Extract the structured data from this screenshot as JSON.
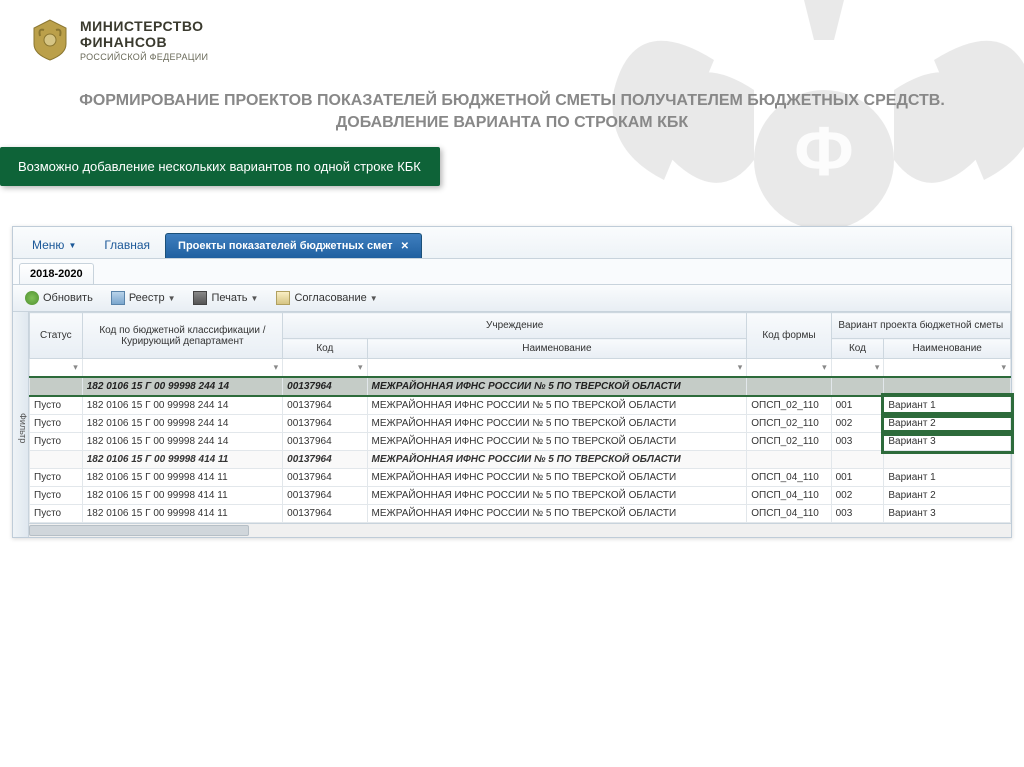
{
  "header": {
    "ministry_line1": "МИНИСТЕРСТВО",
    "ministry_line2": "ФИНАНСОВ",
    "ministry_line3": "РОССИЙСКОЙ ФЕДЕРАЦИИ"
  },
  "title": "ФОРМИРОВАНИЕ ПРОЕКТОВ ПОКАЗАТЕЛЕЙ БЮДЖЕТНОЙ СМЕТЫ ПОЛУЧАТЕЛЕМ БЮДЖЕТНЫХ СРЕДСТВ. ДОБАВЛЕНИЕ ВАРИАНТА ПО СТРОКАМ КБК",
  "callout": "Возможно добавление нескольких вариантов по одной строке КБК",
  "tabs": {
    "menu": "Меню",
    "home": "Главная",
    "active": "Проекты показателей бюджетных смет"
  },
  "subtab": "2018-2020",
  "toolbar": {
    "refresh": "Обновить",
    "registry": "Реестр",
    "print": "Печать",
    "approval": "Согласование"
  },
  "filter_label": "Фильтр",
  "columns": {
    "status": "Статус",
    "kbk": "Код по бюджетной классификации / Курирующий департамент",
    "institution": "Учреждение",
    "inst_kod": "Код",
    "inst_name": "Наименование",
    "form": "Код формы",
    "variant": "Вариант проекта бюджетной сметы",
    "var_kod": "Код",
    "var_name": "Наименование"
  },
  "groups": [
    {
      "highlight": true,
      "kbk": "182 0106 15 Г 00 99998 244 14",
      "kod": "00137964",
      "name": "МЕЖРАЙОННАЯ ИФНС РОССИИ № 5 ПО ТВЕРСКОЙ ОБЛАСТИ",
      "rows": [
        {
          "status": "Пусто",
          "kbk": "182 0106 15 Г 00 99998 244 14",
          "kod": "00137964",
          "name": "МЕЖРАЙОННАЯ ИФНС РОССИИ № 5 ПО ТВЕРСКОЙ ОБЛАСТИ",
          "form": "ОПСП_02_110",
          "vkod": "001",
          "vname": "Вариант 1"
        },
        {
          "status": "Пусто",
          "kbk": "182 0106 15 Г 00 99998 244 14",
          "kod": "00137964",
          "name": "МЕЖРАЙОННАЯ ИФНС РОССИИ № 5 ПО ТВЕРСКОЙ ОБЛАСТИ",
          "form": "ОПСП_02_110",
          "vkod": "002",
          "vname": "Вариант 2"
        },
        {
          "status": "Пусто",
          "kbk": "182 0106 15 Г 00 99998 244 14",
          "kod": "00137964",
          "name": "МЕЖРАЙОННАЯ ИФНС РОССИИ № 5 ПО ТВЕРСКОЙ ОБЛАСТИ",
          "form": "ОПСП_02_110",
          "vkod": "003",
          "vname": "Вариант 3"
        }
      ]
    },
    {
      "highlight": false,
      "kbk": "182 0106 15 Г 00 99998 414 11",
      "kod": "00137964",
      "name": "МЕЖРАЙОННАЯ ИФНС РОССИИ № 5 ПО ТВЕРСКОЙ ОБЛАСТИ",
      "rows": [
        {
          "status": "Пусто",
          "kbk": "182 0106 15 Г 00 99998 414 11",
          "kod": "00137964",
          "name": "МЕЖРАЙОННАЯ ИФНС РОССИИ № 5 ПО ТВЕРСКОЙ ОБЛАСТИ",
          "form": "ОПСП_04_110",
          "vkod": "001",
          "vname": "Вариант 1"
        },
        {
          "status": "Пусто",
          "kbk": "182 0106 15 Г 00 99998 414 11",
          "kod": "00137964",
          "name": "МЕЖРАЙОННАЯ ИФНС РОССИИ № 5 ПО ТВЕРСКОЙ ОБЛАСТИ",
          "form": "ОПСП_04_110",
          "vkod": "002",
          "vname": "Вариант 2"
        },
        {
          "status": "Пусто",
          "kbk": "182 0106 15 Г 00 99998 414 11",
          "kod": "00137964",
          "name": "МЕЖРАЙОННАЯ ИФНС РОССИИ № 5 ПО ТВЕРСКОЙ ОБЛАСТИ",
          "form": "ОПСП_04_110",
          "vkod": "003",
          "vname": "Вариант 3"
        }
      ]
    }
  ]
}
